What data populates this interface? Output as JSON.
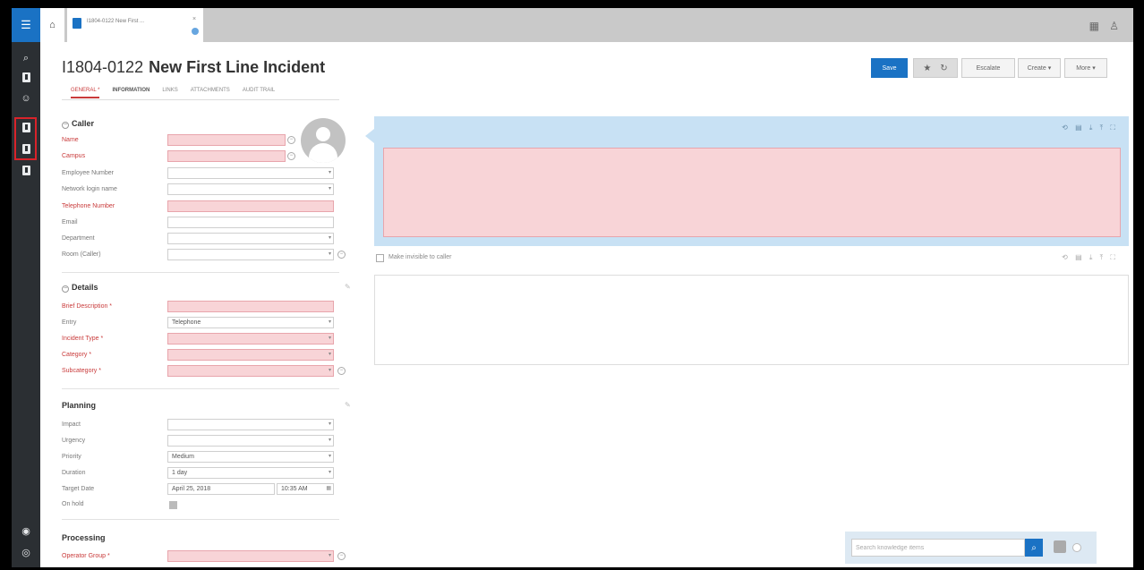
{
  "topbar": {
    "tab_title": "I1804-0122 New First ...",
    "tab_close": "×"
  },
  "record": {
    "number": "I1804-0122",
    "title": "New First Line Incident"
  },
  "tabs": [
    {
      "label": "GENERAL *"
    },
    {
      "label": "INFORMATION"
    },
    {
      "label": "LINKS"
    },
    {
      "label": "ATTACHMENTS"
    },
    {
      "label": "AUDIT TRAIL"
    }
  ],
  "actions": {
    "save": "Save",
    "escalate": "Escalate",
    "create": "Create",
    "more": "More",
    "caret": "▾"
  },
  "caller": {
    "title": "Caller",
    "fields": [
      {
        "label": "Name",
        "value": "",
        "required": true
      },
      {
        "label": "Campus",
        "value": "",
        "required": true
      },
      {
        "label": "Employee Number",
        "value": ""
      },
      {
        "label": "Network login name",
        "value": ""
      },
      {
        "label": "Telephone Number",
        "value": "",
        "required": true
      },
      {
        "label": "Email",
        "value": ""
      },
      {
        "label": "Department",
        "value": ""
      },
      {
        "label": "Room (Caller)",
        "value": ""
      }
    ]
  },
  "details": {
    "title": "Details",
    "fields": [
      {
        "label": "Brief Description *",
        "value": "",
        "required": true
      },
      {
        "label": "Entry",
        "value": "Telephone"
      },
      {
        "label": "Incident Type *",
        "value": "",
        "required": true
      },
      {
        "label": "Category *",
        "value": "",
        "required": true
      },
      {
        "label": "Subcategory *",
        "value": "",
        "required": true
      }
    ]
  },
  "planning": {
    "title": "Planning",
    "fields": [
      {
        "label": "Impact",
        "value": ""
      },
      {
        "label": "Urgency",
        "value": ""
      },
      {
        "label": "Priority",
        "value": "Medium"
      },
      {
        "label": "Duration",
        "value": "1 day"
      },
      {
        "label": "Target Date",
        "value": "April 25, 2018",
        "time": "10:35 AM"
      },
      {
        "label": "On hold",
        "value": ""
      }
    ]
  },
  "processing": {
    "title": "Processing",
    "fields": [
      {
        "label": "Operator Group *",
        "value": "",
        "required": true
      }
    ]
  },
  "notes": {
    "visibility_label": "Make invisible to caller"
  },
  "knowledge": {
    "placeholder": "Search knowledge items"
  }
}
